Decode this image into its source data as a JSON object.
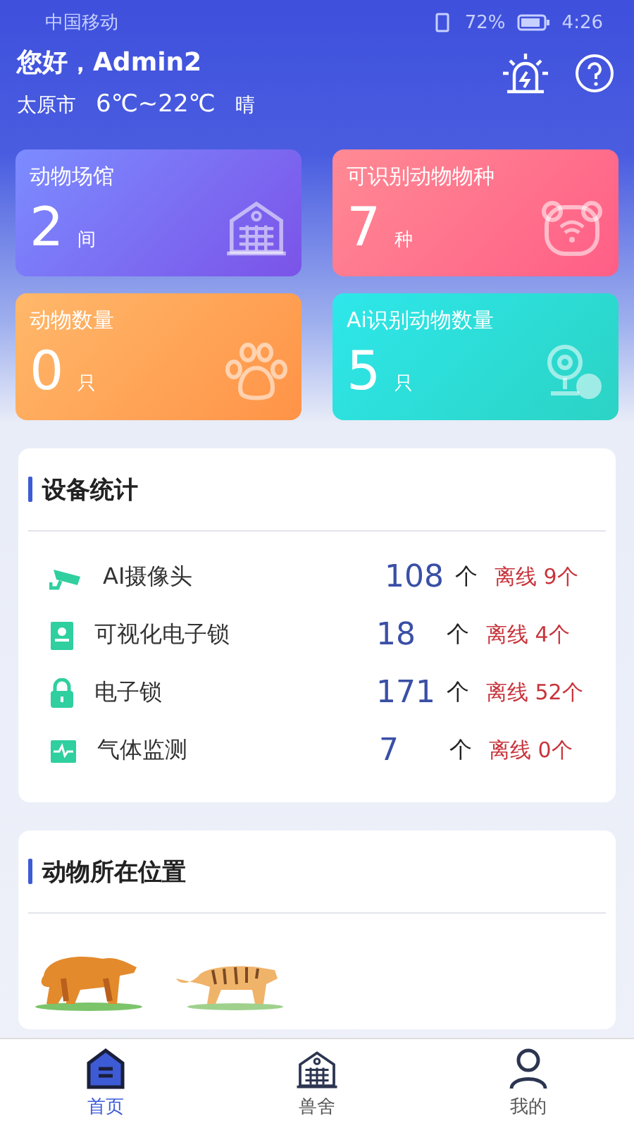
{
  "status_bar": {
    "carrier": "中国移动",
    "battery": "72%",
    "time": "4:26"
  },
  "header": {
    "greeting": "您好，Admin2",
    "city": "太原市",
    "temperature": "6℃~22℃",
    "weather": "晴"
  },
  "stats": [
    {
      "title": "动物场馆",
      "value": "2",
      "unit": "间",
      "kind": "building"
    },
    {
      "title": "可识别动物物种",
      "value": "7",
      "unit": "种",
      "kind": "bear"
    },
    {
      "title": "动物数量",
      "value": "0",
      "unit": "只",
      "kind": "paw"
    },
    {
      "title": "Ai识别动物数量",
      "value": "5",
      "unit": "只",
      "kind": "camera"
    }
  ],
  "devices": {
    "title": "设备统计",
    "rows": [
      {
        "kind": "camera",
        "name": "AI摄像头",
        "count": "108",
        "unit": "个",
        "offline": "离线 9个"
      },
      {
        "kind": "panel",
        "name": "可视化电子锁",
        "count": "18",
        "unit": "个",
        "offline": "离线 4个"
      },
      {
        "kind": "lock",
        "name": "电子锁",
        "count": "171",
        "unit": "个",
        "offline": "离线 52个"
      },
      {
        "kind": "monitor",
        "name": "气体监测",
        "count": "7",
        "unit": "个",
        "offline": "离线 0个"
      }
    ]
  },
  "locations": {
    "title": "动物所在位置",
    "animals": [
      {
        "kind": "bear"
      },
      {
        "kind": "tiger"
      }
    ]
  },
  "tabs": [
    {
      "label": "首页",
      "selected": true,
      "kind": "home"
    },
    {
      "label": "兽舍",
      "selected": false,
      "kind": "building"
    },
    {
      "label": "我的",
      "selected": false,
      "kind": "user"
    }
  ]
}
